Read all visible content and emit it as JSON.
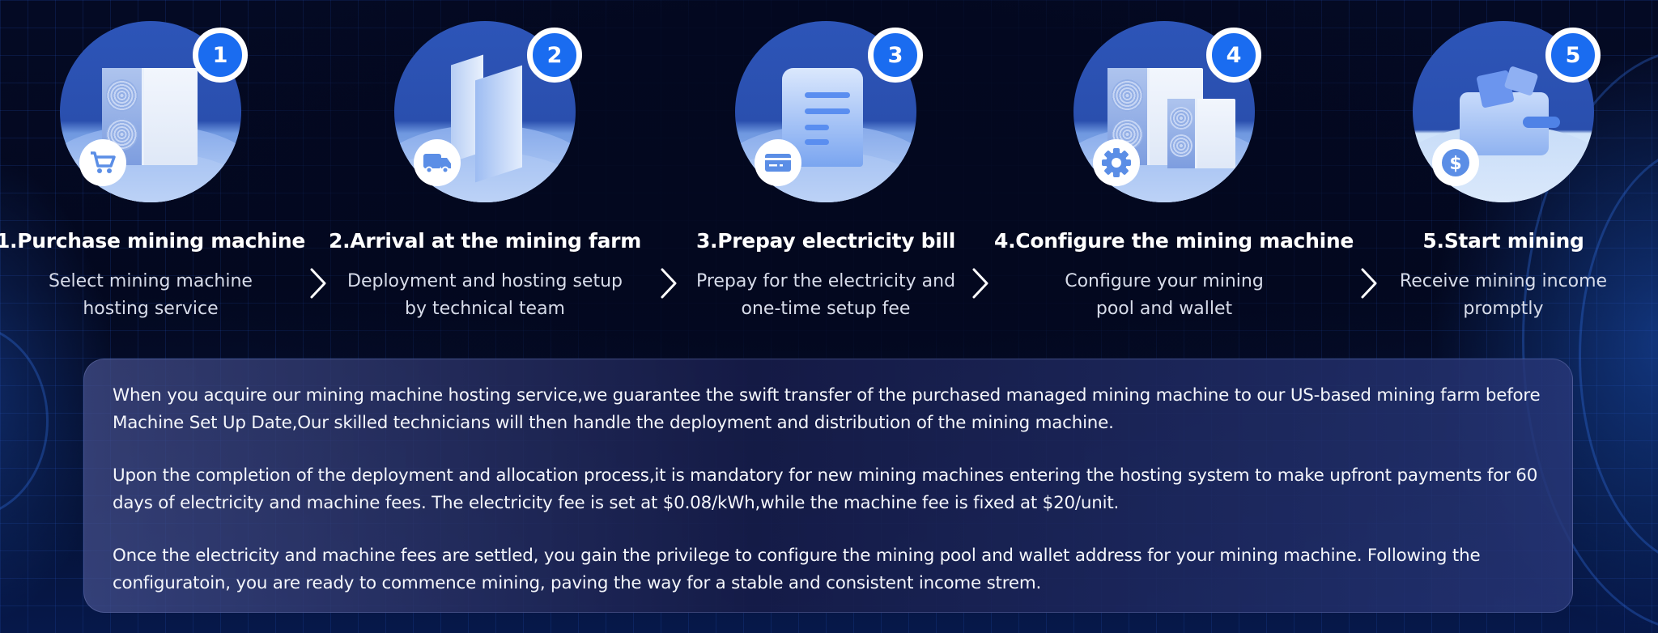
{
  "steps": [
    {
      "number": "1",
      "title": "1.Purchase mining machine",
      "desc_line1": "Select mining machine",
      "desc_line2": "hosting service",
      "illustration": "mining-machine",
      "badge_icon": "cart-icon"
    },
    {
      "number": "2",
      "title": "2.Arrival at the mining farm",
      "desc_line1": "Deployment and hosting setup",
      "desc_line2": "by technical team",
      "illustration": "server-racks",
      "badge_icon": "truck-icon"
    },
    {
      "number": "3",
      "title": "3.Prepay electricity bill",
      "desc_line1": "Prepay for the electricity and",
      "desc_line2": "one-time setup fee",
      "illustration": "bill-scroll",
      "badge_icon": "credit-card-icon"
    },
    {
      "number": "4",
      "title": "4.Configure the mining machine",
      "desc_line1": "Configure your mining",
      "desc_line2": "pool and wallet",
      "illustration": "two-mining-machines",
      "badge_icon": "gear-icon"
    },
    {
      "number": "5",
      "title": "5.Start mining",
      "desc_line1": "Receive mining income",
      "desc_line2": "promptly",
      "illustration": "wallet",
      "badge_icon": "dollar-icon"
    }
  ],
  "separator_icon": "chevron-right-icon",
  "info": {
    "paragraph1": "When you acquire our mining machine hosting service,we guarantee the swift transfer of the purchased managed mining machine to our US-based mining farm before Machine Set Up Date,Our skilled technicians will then handle the deployment and distribution of the mining machine.",
    "paragraph2": "Upon the completion of the deployment and allocation process,it is mandatory for new mining machines entering the hosting system to make upfront payments for 60 days of electricity and machine fees. The electricity fee is set at $0.08/kWh,while the machine fee is fixed at $20/unit.",
    "paragraph3": "Once the electricity and machine fees are settled, you gain the privilege to configure the mining pool and wallet address for your mining machine. Following the configuratoin, you are ready to commence mining, paving the way for a stable and consistent income strem."
  },
  "colors": {
    "badge_blue": "#1a6cf0",
    "background_navy": "#03081f",
    "circle_blue": "#2d55b8",
    "icon_blue": "#5b8ee6"
  }
}
